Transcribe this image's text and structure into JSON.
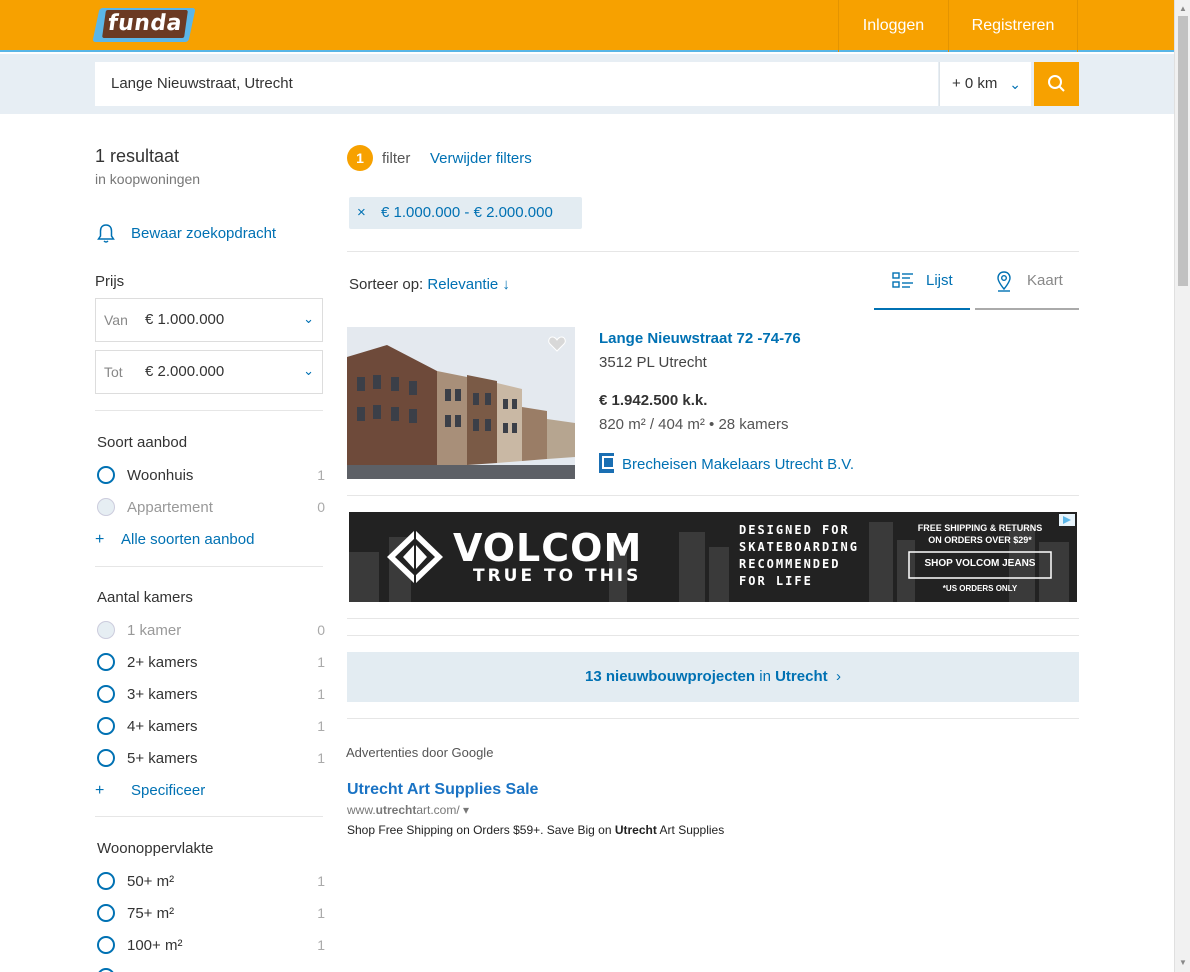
{
  "header": {
    "logo_text": "funda",
    "login_label": "Inloggen",
    "register_label": "Registreren"
  },
  "search": {
    "query": "Lange Nieuwstraat, Utrecht",
    "radius": "+ 0 km"
  },
  "sidebar": {
    "result_count": "1 resultaat",
    "result_sub": "in koopwoningen",
    "save_search": "Bewaar zoekopdracht",
    "price": {
      "title": "Prijs",
      "from_label": "Van",
      "from_value": "€ 1.000.000",
      "to_label": "Tot",
      "to_value": "€ 2.000.000"
    },
    "offer_type": {
      "title": "Soort aanbod",
      "options": [
        {
          "label": "Woonhuis",
          "count": "1"
        },
        {
          "label": "Appartement",
          "count": "0"
        }
      ],
      "more": "Alle soorten aanbod"
    },
    "rooms": {
      "title": "Aantal kamers",
      "options": [
        {
          "label": "1 kamer",
          "count": "0"
        },
        {
          "label": "2+ kamers",
          "count": "1"
        },
        {
          "label": "3+ kamers",
          "count": "1"
        },
        {
          "label": "4+ kamers",
          "count": "1"
        },
        {
          "label": "5+ kamers",
          "count": "1"
        }
      ],
      "more": "Specificeer"
    },
    "area": {
      "title": "Woonoppervlakte",
      "options": [
        {
          "label": "50+ m²",
          "count": "1"
        },
        {
          "label": "75+ m²",
          "count": "1"
        },
        {
          "label": "100+ m²",
          "count": "1"
        }
      ]
    }
  },
  "filters": {
    "count": "1",
    "word": "filter",
    "remove_label": "Verwijder filters",
    "chip": "€ 1.000.000 - € 2.000.000"
  },
  "sort": {
    "label": "Sorteer op:",
    "value": "Relevantie ↓"
  },
  "view_tabs": {
    "list": "Lijst",
    "map": "Kaart"
  },
  "listing": {
    "address": "Lange Nieuwstraat 72 -74-76",
    "city": "3512 PL Utrecht",
    "price": "€ 1.942.500 k.k.",
    "specs": "820 m² / 404 m²  •  28 kamers",
    "agent": "Brecheisen Makelaars Utrecht B.V."
  },
  "banner": {
    "brand": "VOLCOM",
    "tagline": "TRUE TO THIS",
    "line1": "DESIGNED FOR",
    "line2": "SKATEBOARDING",
    "line3": "RECOMMENDED",
    "line4": "FOR LIFE",
    "ship1": "FREE SHIPPING & RETURNS",
    "ship2": "ON ORDERS OVER $29*",
    "cta": "SHOP VOLCOM JEANS",
    "note": "*US ORDERS ONLY"
  },
  "promo": {
    "count_text": "13 nieuwbouwprojecten",
    "in_text": "in",
    "city": "Utrecht"
  },
  "google_ad": {
    "ads_by": "Advertenties door Google",
    "title": "Utrecht Art Supplies Sale",
    "url_prefix": "www.",
    "url_bold": "utrecht",
    "url_suffix": "art.com/",
    "desc_before": "Shop Free Shipping on Orders $59+. Save Big on ",
    "desc_bold": "Utrecht",
    "desc_after": " Art Supplies"
  }
}
